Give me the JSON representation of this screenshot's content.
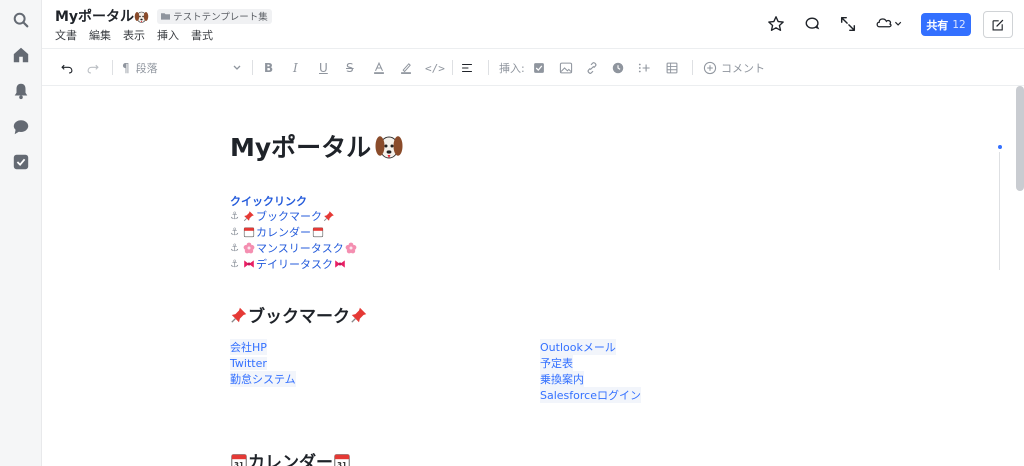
{
  "header": {
    "title": "Myポータル",
    "folder": "テストテンプレート集",
    "menu": [
      "文書",
      "編集",
      "表示",
      "挿入",
      "書式"
    ],
    "share_label": "共有",
    "share_count": "12"
  },
  "toolbar": {
    "paragraph_label": "段落",
    "insert_label": "挿入:",
    "comment_label": "コメント"
  },
  "doc": {
    "h1": "Myポータル",
    "quick_heading": "クイックリンク",
    "quick_links": [
      "ブックマーク",
      "カレンダー",
      "マンスリータスク",
      "デイリータスク"
    ],
    "bookmark_heading": "ブックマーク",
    "bookmarks_left": [
      "会社HP",
      "Twitter",
      "勤怠システム"
    ],
    "bookmarks_right": [
      "Outlookメール",
      "予定表",
      "乗換案内",
      "Salesforceログイン"
    ],
    "calendar_heading": "カレンダー",
    "calendar_day": "31"
  },
  "colors": {
    "accent": "#3370ff",
    "link": "#245bdb",
    "share_button": "#3370ff"
  }
}
